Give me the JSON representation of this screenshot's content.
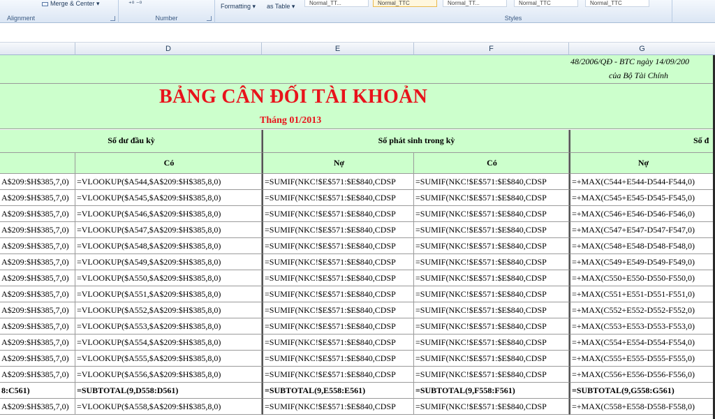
{
  "ribbon": {
    "alignment_label": "Alignment",
    "merge_label": "Merge & Center",
    "number_label": "Number",
    "formatting_label": "Formatting",
    "as_table_label": "as Table",
    "styles_label": "Styles",
    "style_tiles": [
      "Normal_TT...",
      "Normal_TTC",
      "Normal_TT...",
      "Normal_TTC",
      "Normal_TTC"
    ]
  },
  "columns": [
    "D",
    "E",
    "F",
    "G"
  ],
  "header_note": {
    "line1": "48/2006/QĐ - BTC ngày 14/09/200",
    "line2": "của Bộ Tài Chính"
  },
  "title": "BẢNG CÂN ĐỐI TÀI KHOẢN",
  "subtitle": "Tháng 01/2013",
  "groups": {
    "opening": "Số dư đầu kỳ",
    "period": "Số phát sinh trong kỳ",
    "closing": "Số đ"
  },
  "subheaders": {
    "d": "Có",
    "e": "Nợ",
    "f": "Có",
    "g": "Nợ"
  },
  "rows": [
    {
      "c": "A$209:$H$385,7,0)",
      "d": "=VLOOKUP($A544,$A$209:$H$385,8,0)",
      "e": "=SUMIF(NKC!$E$571:$E$840,CDSP",
      "f": "=SUMIF(NKC!$E$571:$E$840,CDSP",
      "g": "=+MAX(C544+E544-D544-F544,0)"
    },
    {
      "c": "A$209:$H$385,7,0)",
      "d": "=VLOOKUP($A545,$A$209:$H$385,8,0)",
      "e": "=SUMIF(NKC!$E$571:$E$840,CDSP",
      "f": "=SUMIF(NKC!$E$571:$E$840,CDSP",
      "g": "=+MAX(C545+E545-D545-F545,0)"
    },
    {
      "c": "A$209:$H$385,7,0)",
      "d": "=VLOOKUP($A546,$A$209:$H$385,8,0)",
      "e": "=SUMIF(NKC!$E$571:$E$840,CDSP",
      "f": "=SUMIF(NKC!$E$571:$E$840,CDSP",
      "g": "=+MAX(C546+E546-D546-F546,0)"
    },
    {
      "c": "A$209:$H$385,7,0)",
      "d": "=VLOOKUP($A547,$A$209:$H$385,8,0)",
      "e": "=SUMIF(NKC!$E$571:$E$840,CDSP",
      "f": "=SUMIF(NKC!$E$571:$E$840,CDSP",
      "g": "=+MAX(C547+E547-D547-F547,0)"
    },
    {
      "c": "A$209:$H$385,7,0)",
      "d": "=VLOOKUP($A548,$A$209:$H$385,8,0)",
      "e": "=SUMIF(NKC!$E$571:$E$840,CDSP",
      "f": "=SUMIF(NKC!$E$571:$E$840,CDSP",
      "g": "=+MAX(C548+E548-D548-F548,0)"
    },
    {
      "c": "A$209:$H$385,7,0)",
      "d": "=VLOOKUP($A549,$A$209:$H$385,8,0)",
      "e": "=SUMIF(NKC!$E$571:$E$840,CDSP",
      "f": "=SUMIF(NKC!$E$571:$E$840,CDSP",
      "g": "=+MAX(C549+E549-D549-F549,0)"
    },
    {
      "c": "A$209:$H$385,7,0)",
      "d": "=VLOOKUP($A550,$A$209:$H$385,8,0)",
      "e": "=SUMIF(NKC!$E$571:$E$840,CDSP",
      "f": "=SUMIF(NKC!$E$571:$E$840,CDSP",
      "g": "=+MAX(C550+E550-D550-F550,0)"
    },
    {
      "c": "A$209:$H$385,7,0)",
      "d": "=VLOOKUP($A551,$A$209:$H$385,8,0)",
      "e": "=SUMIF(NKC!$E$571:$E$840,CDSP",
      "f": "=SUMIF(NKC!$E$571:$E$840,CDSP",
      "g": "=+MAX(C551+E551-D551-F551,0)"
    },
    {
      "c": "A$209:$H$385,7,0)",
      "d": "=VLOOKUP($A552,$A$209:$H$385,8,0)",
      "e": "=SUMIF(NKC!$E$571:$E$840,CDSP",
      "f": "=SUMIF(NKC!$E$571:$E$840,CDSP",
      "g": "=+MAX(C552+E552-D552-F552,0)"
    },
    {
      "c": "A$209:$H$385,7,0)",
      "d": "=VLOOKUP($A553,$A$209:$H$385,8,0)",
      "e": "=SUMIF(NKC!$E$571:$E$840,CDSP",
      "f": "=SUMIF(NKC!$E$571:$E$840,CDSP",
      "g": "=+MAX(C553+E553-D553-F553,0)"
    },
    {
      "c": "A$209:$H$385,7,0)",
      "d": "=VLOOKUP($A554,$A$209:$H$385,8,0)",
      "e": "=SUMIF(NKC!$E$571:$E$840,CDSP",
      "f": "=SUMIF(NKC!$E$571:$E$840,CDSP",
      "g": "=+MAX(C554+E554-D554-F554,0)"
    },
    {
      "c": "A$209:$H$385,7,0)",
      "d": "=VLOOKUP($A555,$A$209:$H$385,8,0)",
      "e": "=SUMIF(NKC!$E$571:$E$840,CDSP",
      "f": "=SUMIF(NKC!$E$571:$E$840,CDSP",
      "g": "=+MAX(C555+E555-D555-F555,0)"
    },
    {
      "c": "A$209:$H$385,7,0)",
      "d": "=VLOOKUP($A556,$A$209:$H$385,8,0)",
      "e": "=SUMIF(NKC!$E$571:$E$840,CDSP",
      "f": "=SUMIF(NKC!$E$571:$E$840,CDSP",
      "g": "=+MAX(C556+E556-D556-F556,0)"
    },
    {
      "c": "8:C561)",
      "d": "=SUBTOTAL(9,D558:D561)",
      "e": "=SUBTOTAL(9,E558:E561)",
      "f": "=SUBTOTAL(9,F558:F561)",
      "g": "=SUBTOTAL(9,G558:G561)",
      "total": true
    },
    {
      "c": "A$209:$H$385,7,0)",
      "d": "=VLOOKUP($A558,$A$209:$H$385,8,0)",
      "e": "=SUMIF(NKC!$E$571:$E$840,CDSP",
      "f": "=SUMIF(NKC!$E$571:$E$840,CDSP",
      "g": "=+MAX(C558+E558-D558-F558,0)"
    }
  ]
}
